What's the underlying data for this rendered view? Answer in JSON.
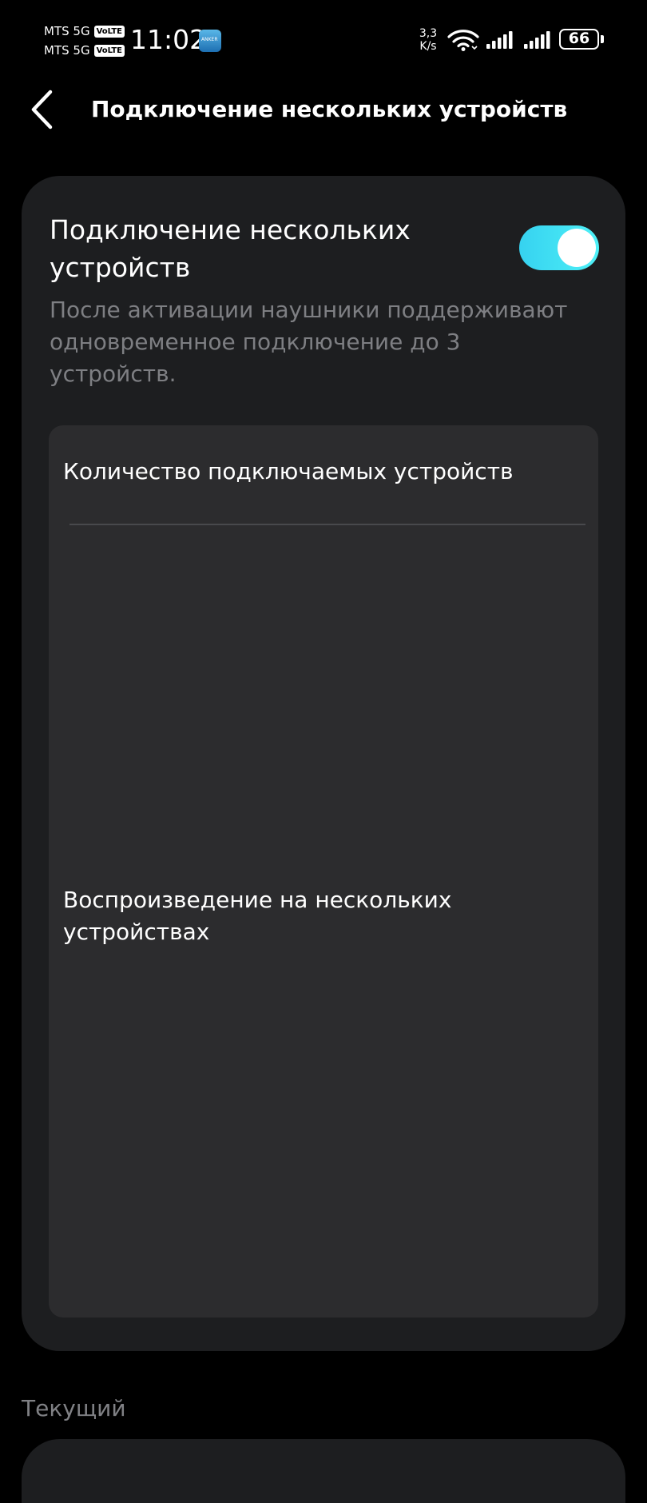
{
  "status_bar": {
    "carrier_1": "MTS 5G",
    "carrier_2": "MTS 5G",
    "volte_badge": "VoLTE",
    "time": "11:02",
    "notification_app_label": "ANKER",
    "net_speed_value": "3,3",
    "net_speed_unit": "K/s",
    "battery": "66",
    "icons": [
      "app-notification-icon",
      "wifi-icon",
      "signal-icon",
      "signal-icon",
      "battery-icon"
    ]
  },
  "header": {
    "back_icon": "chevron-left-icon",
    "title": "Подключение нескольких устройств"
  },
  "multipoint": {
    "title_line_1": "Подключение нескольких",
    "title_line_2": "устройств",
    "toggle_on": true,
    "toggle_color": "#3fe0f4",
    "description_line_1": "После активации наушники поддерживают",
    "description_line_2": "одновременное подключение до 3",
    "description_line_3": "устройств."
  },
  "options": {
    "device_count_label": "Количество подключаемых устройств",
    "multi_play_line_1": "Воспроизведение на нескольких",
    "multi_play_line_2": "устройствах"
  },
  "current_section": {
    "label": "Текущий"
  }
}
